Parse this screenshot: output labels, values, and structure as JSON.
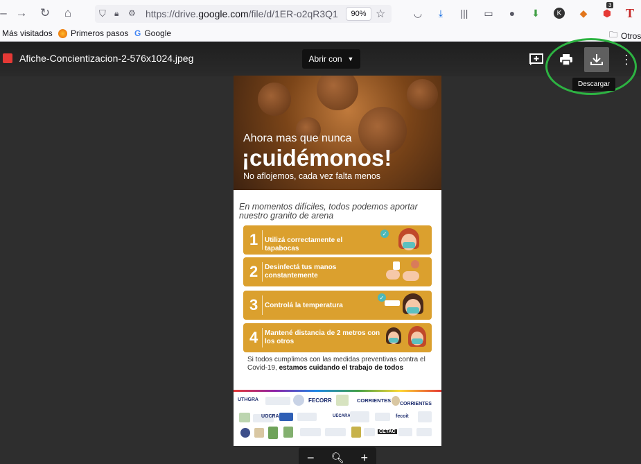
{
  "browser": {
    "url_prefix": "https://drive.",
    "url_domain": "google.com",
    "url_suffix": "/file/d/1ER-o2qR3Q1",
    "zoom": "90%",
    "shield_badge": "3"
  },
  "bookmarks": {
    "items": [
      {
        "label": "Más visitados"
      },
      {
        "label": "Primeros pasos"
      },
      {
        "label": "Google"
      }
    ],
    "other": "Otros"
  },
  "viewer": {
    "file_title": "Afiche-Concientizacion-2-576x1024.jpeg",
    "open_with": "Abrir con",
    "download_tooltip": "Descargar"
  },
  "poster": {
    "headline_1": "Ahora mas que nunca",
    "headline_2": "¡cuidémonos!",
    "headline_3": "No aflojemos, cada vez falta menos",
    "intro": "En momentos difíciles, todos podemos aportar nuestro granito de arena",
    "steps": [
      {
        "num": "1",
        "text": "Utilizá correctamente el tapabocas"
      },
      {
        "num": "2",
        "text": "Desinfectá tus manos constantemente"
      },
      {
        "num": "3",
        "text": "Controlá la temperatura"
      },
      {
        "num": "4",
        "text": "Mantené distancia de 2 metros con los otros"
      }
    ],
    "footer_plain": "Si todos cumplimos con las medidas preventivas contra el Covid-19, ",
    "footer_bold": "estamos cuidando el trabajo de todos",
    "logos": [
      "UTHGRA",
      "FECORR",
      "CORRIENTES",
      "CORRIENTES",
      "UOCRA",
      "UECARA",
      "fecoit",
      "CETAC"
    ]
  },
  "icons": {
    "brand_color": "#2db342",
    "accent": "#dba02e"
  }
}
